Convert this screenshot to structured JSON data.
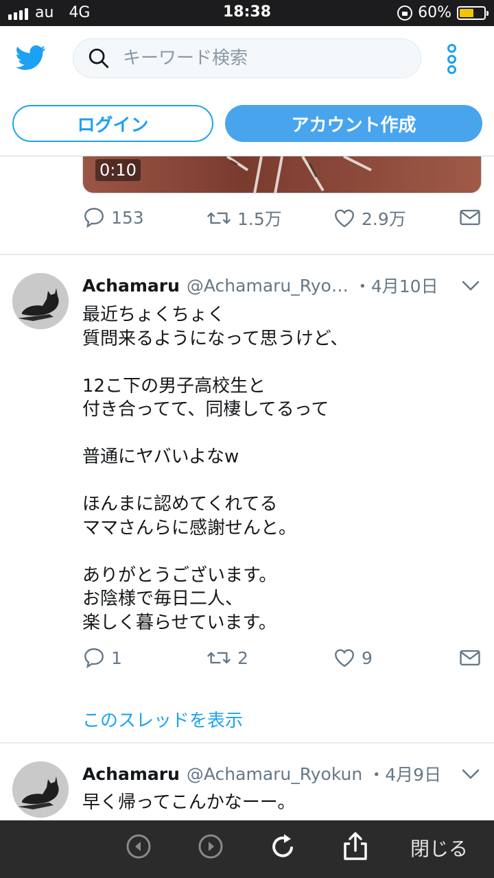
{
  "status_bar": {
    "carrier": "au",
    "network": "4G",
    "time": "18:38",
    "battery": "60%",
    "battery_level": 0.6,
    "battery_color": "#f5c400"
  },
  "header": {
    "logo_icon": "twitter-bird-icon",
    "search_placeholder": "キーワード検索",
    "login_label": "ログイン",
    "signup_label": "アカウント作成",
    "accent_color": "#1da1f2"
  },
  "prev_tweet": {
    "video_duration": "0:10",
    "replies": "153",
    "retweets": "1.5万",
    "likes": "2.9万"
  },
  "tweets": [
    {
      "name": "Achamaru",
      "handle": "@Achamaru_Ryo…",
      "date": "・4月10日",
      "lines": [
        "最近ちょくちょく",
        "質問来るようになって思うけど、",
        "",
        "12こ下の男子高校生と",
        "付き合ってて、同棲してるって",
        "",
        "普通にヤバいよなw",
        "",
        "ほんまに認めてくれてる",
        "ママさんらに感謝せんと。",
        "",
        "ありがとうございます。",
        "お陰様で毎日二人、",
        "楽しく暮らせています。"
      ],
      "replies": "1",
      "retweets": "2",
      "likes": "9",
      "thread_link": "このスレッドを表示"
    },
    {
      "name": "Achamaru",
      "handle": "@Achamaru_Ryokun",
      "date": "・4月9日",
      "lines": [
        "早く帰ってこんかなーー。"
      ]
    }
  ],
  "bottom_bar": {
    "close_label": "閉じる"
  }
}
